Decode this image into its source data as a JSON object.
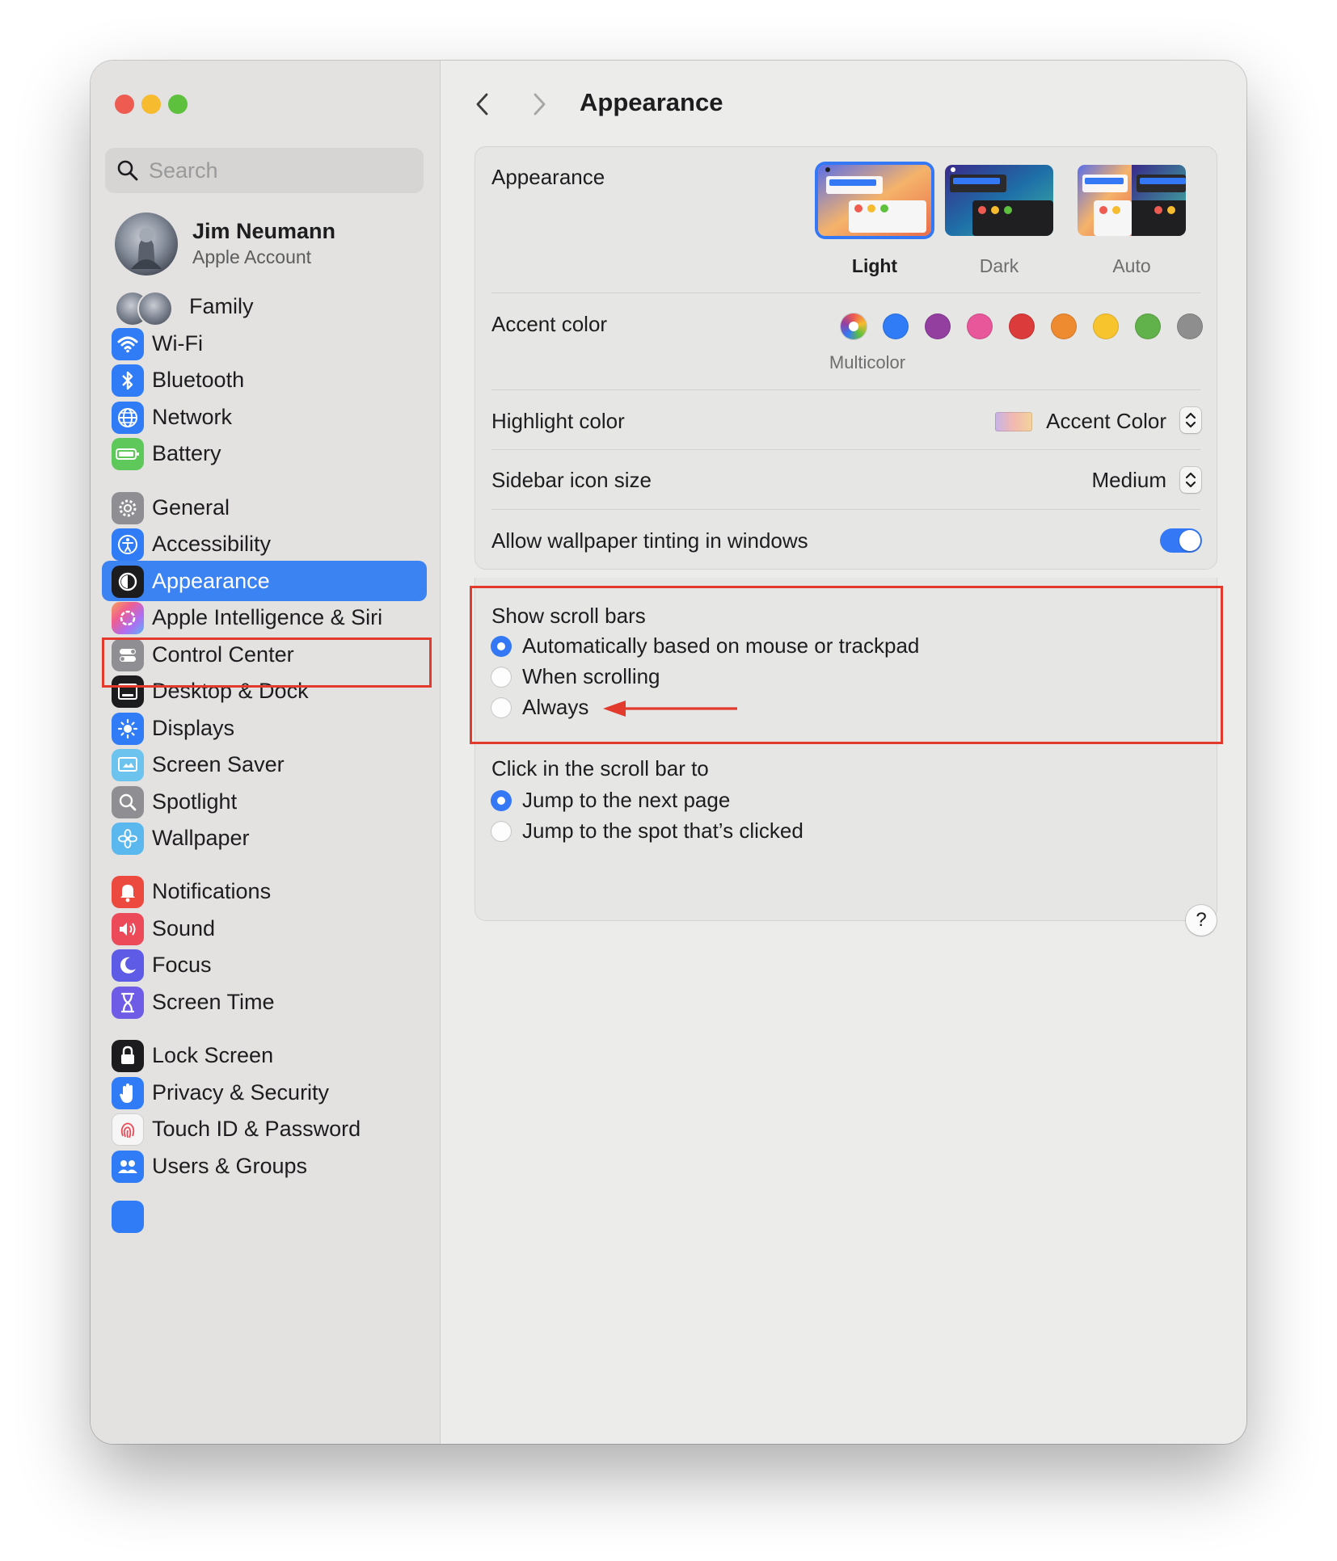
{
  "sidebar": {
    "search_placeholder": "Search",
    "account": {
      "name": "Jim Neumann",
      "subtitle": "Apple Account"
    },
    "family_label": "Family",
    "items": [
      {
        "label": "Wi-Fi",
        "icon": "wifi-icon",
        "color": "#2f7cf6"
      },
      {
        "label": "Bluetooth",
        "icon": "bluetooth-icon",
        "color": "#2f7cf6"
      },
      {
        "label": "Network",
        "icon": "globe-icon",
        "color": "#2f7cf6"
      },
      {
        "label": "Battery",
        "icon": "battery-icon",
        "color": "#5fc85a"
      },
      {
        "label": "General",
        "icon": "gear-icon",
        "color": "#8e8e93"
      },
      {
        "label": "Accessibility",
        "icon": "accessibility-icon",
        "color": "#2f7cf6"
      },
      {
        "label": "Appearance",
        "icon": "appearance-icon",
        "color": "#1c1c1e",
        "selected": true
      },
      {
        "label": "Apple Intelligence & Siri",
        "icon": "apple-intelligence-icon",
        "color": "#f2a5a0"
      },
      {
        "label": "Control Center",
        "icon": "control-center-icon",
        "color": "#8e8e93"
      },
      {
        "label": "Desktop & Dock",
        "icon": "desktop-dock-icon",
        "color": "#1c1c1e"
      },
      {
        "label": "Displays",
        "icon": "sun-icon",
        "color": "#2f7cf6"
      },
      {
        "label": "Screen Saver",
        "icon": "screen-saver-icon",
        "color": "#6cc4ee"
      },
      {
        "label": "Spotlight",
        "icon": "magnifier-icon",
        "color": "#8e8e93"
      },
      {
        "label": "Wallpaper",
        "icon": "flower-icon",
        "color": "#5ab8ee"
      },
      {
        "label": "Notifications",
        "icon": "bell-icon",
        "color": "#ec4a3f"
      },
      {
        "label": "Sound",
        "icon": "speaker-icon",
        "color": "#ec4a59"
      },
      {
        "label": "Focus",
        "icon": "moon-icon",
        "color": "#5e5ce6"
      },
      {
        "label": "Screen Time",
        "icon": "hourglass-icon",
        "color": "#6e5ce6"
      },
      {
        "label": "Lock Screen",
        "icon": "lock-icon",
        "color": "#1c1c1e"
      },
      {
        "label": "Privacy & Security",
        "icon": "hand-icon",
        "color": "#2f7cf6"
      },
      {
        "label": "Touch ID & Password",
        "icon": "fingerprint-icon",
        "color": "#f6f6f6"
      },
      {
        "label": "Users & Groups",
        "icon": "users-icon",
        "color": "#2f7cf6"
      }
    ]
  },
  "header": {
    "title": "Appearance"
  },
  "appearance": {
    "label": "Appearance",
    "options": [
      {
        "label": "Light",
        "selected": true
      },
      {
        "label": "Dark",
        "selected": false
      },
      {
        "label": "Auto",
        "selected": false
      }
    ]
  },
  "accent": {
    "label": "Accent color",
    "selected_label": "Multicolor",
    "colors": [
      "multicolor",
      "#2f7cf6",
      "#933fa0",
      "#e8579a",
      "#dc3b3b",
      "#ee8a30",
      "#f7c42e",
      "#62b24b",
      "#8e8e8e"
    ]
  },
  "highlight": {
    "label": "Highlight color",
    "value": "Accent Color"
  },
  "sidebar_icon_size": {
    "label": "Sidebar icon size",
    "value": "Medium"
  },
  "wallpaper_tinting": {
    "label": "Allow wallpaper tinting in windows",
    "on": true
  },
  "scroll_bars": {
    "label": "Show scroll bars",
    "options": [
      {
        "label": "Automatically based on mouse or trackpad",
        "selected": true
      },
      {
        "label": "When scrolling",
        "selected": false
      },
      {
        "label": "Always",
        "selected": false
      }
    ]
  },
  "click_scroll": {
    "label": "Click in the scroll bar to",
    "options": [
      {
        "label": "Jump to the next page",
        "selected": true
      },
      {
        "label": "Jump to the spot that’s clicked",
        "selected": false
      }
    ]
  },
  "help_label": "?",
  "annotation_color": "#e23b2e"
}
